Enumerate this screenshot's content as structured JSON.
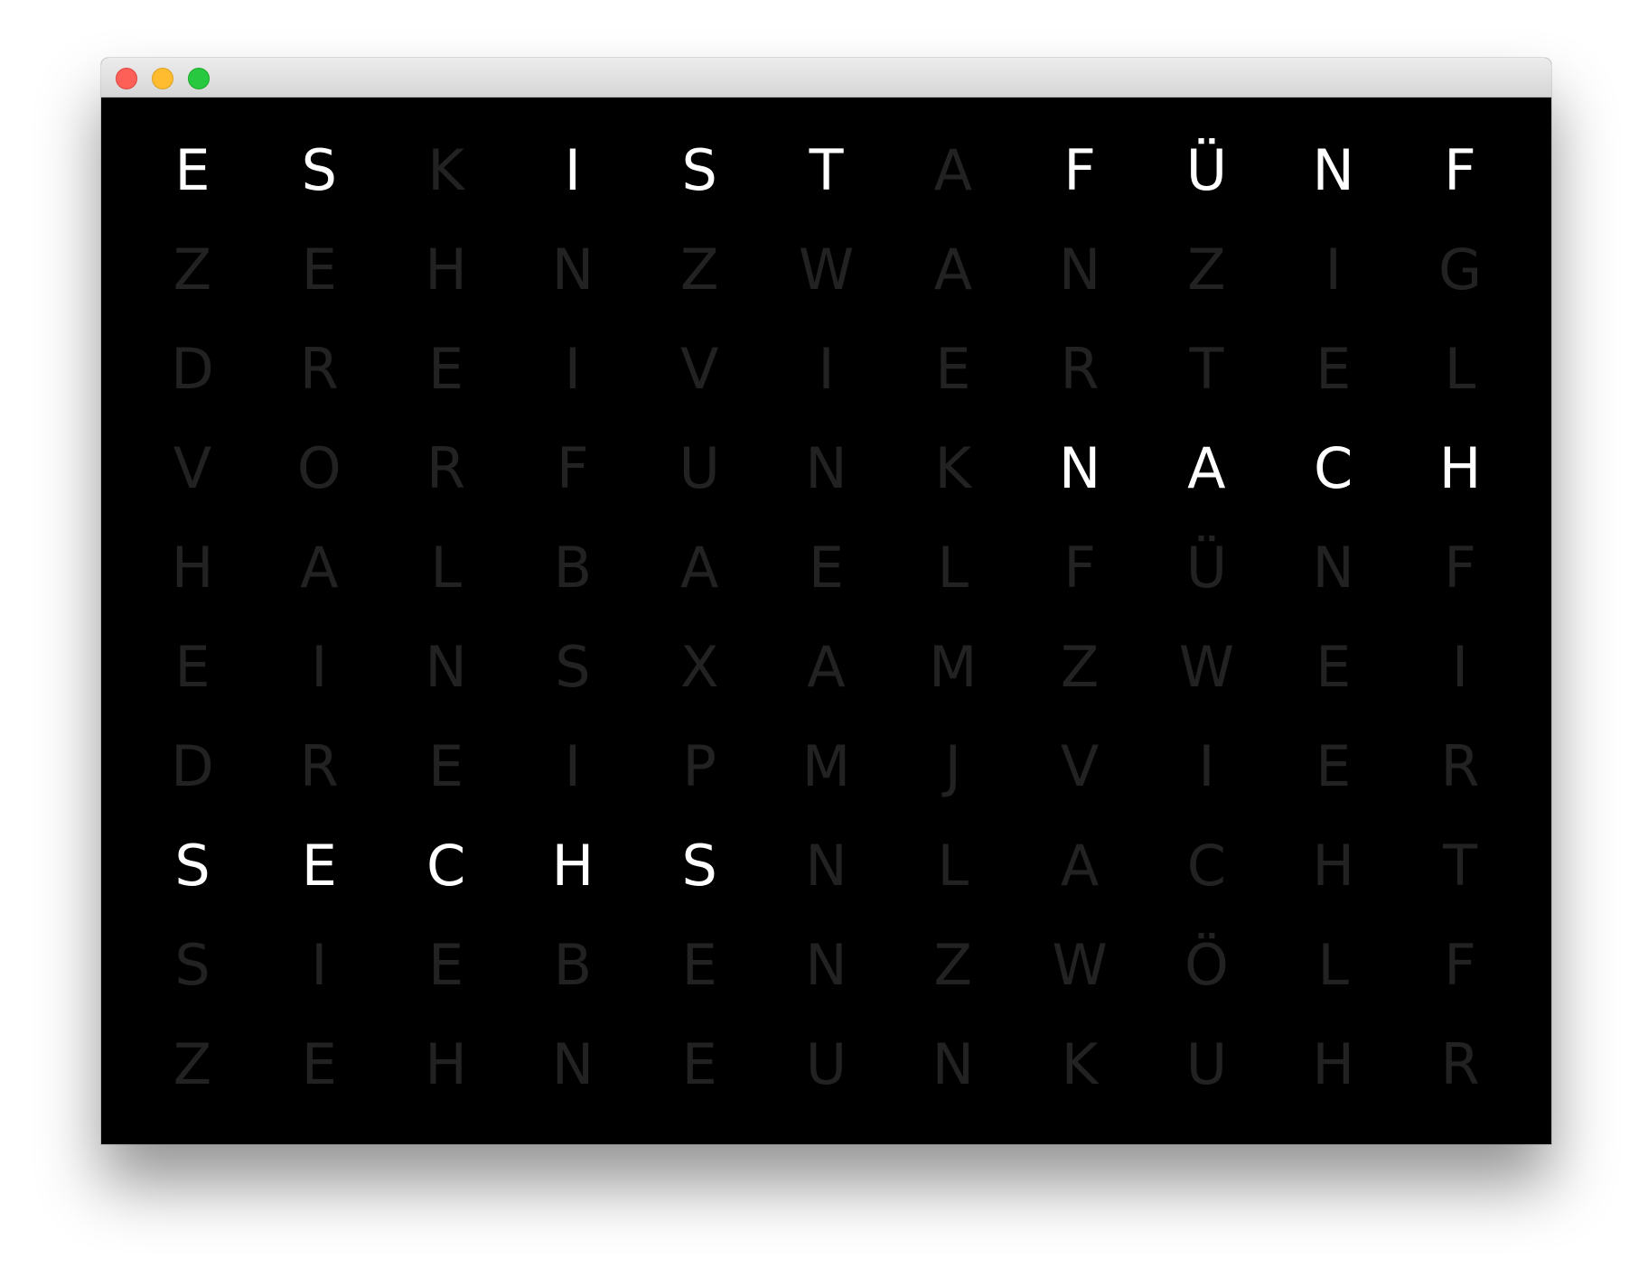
{
  "window": {
    "controls": [
      "close",
      "minimize",
      "zoom"
    ],
    "colors": {
      "close": "#fe5f57",
      "minimize": "#febc2e",
      "zoom": "#28c840"
    }
  },
  "clock": {
    "active_color": "#ffffff",
    "inactive_color": "#222222",
    "background": "#000000",
    "time_phrase": "ES IST FÜNF NACH SECHS",
    "rows": [
      {
        "letters": [
          "E",
          "S",
          "K",
          "I",
          "S",
          "T",
          "A",
          "F",
          "Ü",
          "N",
          "F"
        ],
        "lit": [
          true,
          true,
          false,
          true,
          true,
          true,
          false,
          true,
          true,
          true,
          true
        ]
      },
      {
        "letters": [
          "Z",
          "E",
          "H",
          "N",
          "Z",
          "W",
          "A",
          "N",
          "Z",
          "I",
          "G"
        ],
        "lit": [
          false,
          false,
          false,
          false,
          false,
          false,
          false,
          false,
          false,
          false,
          false
        ]
      },
      {
        "letters": [
          "D",
          "R",
          "E",
          "I",
          "V",
          "I",
          "E",
          "R",
          "T",
          "E",
          "L"
        ],
        "lit": [
          false,
          false,
          false,
          false,
          false,
          false,
          false,
          false,
          false,
          false,
          false
        ]
      },
      {
        "letters": [
          "V",
          "O",
          "R",
          "F",
          "U",
          "N",
          "K",
          "N",
          "A",
          "C",
          "H"
        ],
        "lit": [
          false,
          false,
          false,
          false,
          false,
          false,
          false,
          true,
          true,
          true,
          true
        ]
      },
      {
        "letters": [
          "H",
          "A",
          "L",
          "B",
          "A",
          "E",
          "L",
          "F",
          "Ü",
          "N",
          "F"
        ],
        "lit": [
          false,
          false,
          false,
          false,
          false,
          false,
          false,
          false,
          false,
          false,
          false
        ]
      },
      {
        "letters": [
          "E",
          "I",
          "N",
          "S",
          "X",
          "A",
          "M",
          "Z",
          "W",
          "E",
          "I"
        ],
        "lit": [
          false,
          false,
          false,
          false,
          false,
          false,
          false,
          false,
          false,
          false,
          false
        ]
      },
      {
        "letters": [
          "D",
          "R",
          "E",
          "I",
          "P",
          "M",
          "J",
          "V",
          "I",
          "E",
          "R"
        ],
        "lit": [
          false,
          false,
          false,
          false,
          false,
          false,
          false,
          false,
          false,
          false,
          false
        ]
      },
      {
        "letters": [
          "S",
          "E",
          "C",
          "H",
          "S",
          "N",
          "L",
          "A",
          "C",
          "H",
          "T"
        ],
        "lit": [
          true,
          true,
          true,
          true,
          true,
          false,
          false,
          false,
          false,
          false,
          false
        ]
      },
      {
        "letters": [
          "S",
          "I",
          "E",
          "B",
          "E",
          "N",
          "Z",
          "W",
          "Ö",
          "L",
          "F"
        ],
        "lit": [
          false,
          false,
          false,
          false,
          false,
          false,
          false,
          false,
          false,
          false,
          false
        ]
      },
      {
        "letters": [
          "Z",
          "E",
          "H",
          "N",
          "E",
          "U",
          "N",
          "K",
          "U",
          "H",
          "R"
        ],
        "lit": [
          false,
          false,
          false,
          false,
          false,
          false,
          false,
          false,
          false,
          false,
          false
        ]
      }
    ]
  }
}
